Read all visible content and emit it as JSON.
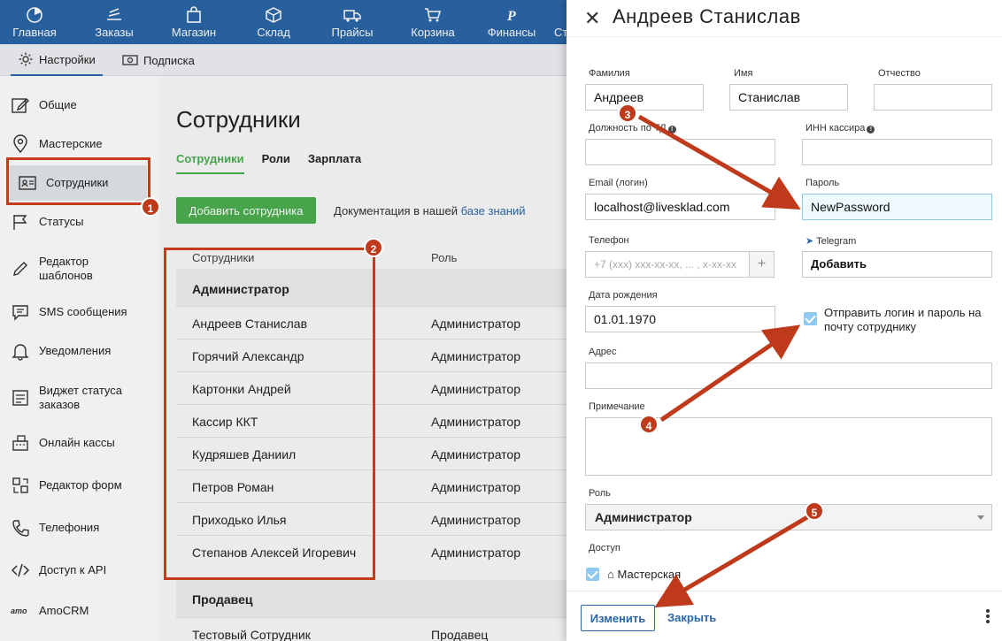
{
  "topnav": {
    "items": [
      {
        "label": "Главная",
        "icon": "dashboard-icon"
      },
      {
        "label": "Заказы",
        "icon": "orders-icon"
      },
      {
        "label": "Магазин",
        "icon": "shop-bag-icon"
      },
      {
        "label": "Склад",
        "icon": "box-icon"
      },
      {
        "label": "Прайсы",
        "icon": "truck-icon"
      },
      {
        "label": "Корзина",
        "icon": "cart-icon"
      },
      {
        "label": "Финансы",
        "icon": "ruble-icon"
      },
      {
        "label": "Ст",
        "icon": ""
      }
    ]
  },
  "subbar": {
    "settings": "Настройки",
    "subscription": "Подписка"
  },
  "sidebar": {
    "items": [
      {
        "label": "Общие"
      },
      {
        "label": "Мастерские"
      },
      {
        "label": "Сотрудники"
      },
      {
        "label": "Статусы"
      },
      {
        "label": "Редактор шаблонов"
      },
      {
        "label": "SMS сообщения"
      },
      {
        "label": "Уведомления"
      },
      {
        "label": "Виджет статуса заказов"
      },
      {
        "label": "Онлайн кассы"
      },
      {
        "label": "Редактор форм"
      },
      {
        "label": "Телефония"
      },
      {
        "label": "Доступ к API"
      },
      {
        "label": "AmoCRM"
      }
    ]
  },
  "main": {
    "title": "Сотрудники",
    "tabs": [
      "Сотрудники",
      "Роли",
      "Зарплата"
    ],
    "add_button": "Добавить сотрудника",
    "doc_prefix": "Документация в нашей",
    "doc_link": "базе знаний",
    "table": {
      "col_name": "Сотрудники",
      "col_role": "Роль",
      "groups": [
        {
          "name": "Администратор",
          "rows": [
            {
              "name": "Андреев Станислав",
              "role": "Администратор"
            },
            {
              "name": "Горячий Александр",
              "role": "Администратор"
            },
            {
              "name": "Картонки Андрей",
              "role": "Администратор"
            },
            {
              "name": "Кассир ККТ",
              "role": "Администратор"
            },
            {
              "name": "Кудряшев Даниил",
              "role": "Администратор"
            },
            {
              "name": "Петров Роман",
              "role": "Администратор"
            },
            {
              "name": "Приходько Илья",
              "role": "Администратор"
            },
            {
              "name": "Степанов Алексей Игоревич",
              "role": "Администратор"
            }
          ]
        },
        {
          "name": "Продавец",
          "rows": [
            {
              "name": "Тестовый Сотрудник",
              "role": "Продавец"
            }
          ]
        }
      ]
    }
  },
  "panel": {
    "title": "Андреев Станислав",
    "labels": {
      "last_name": "Фамилия",
      "first_name": "Имя",
      "middle_name": "Отчество",
      "position": "Должность по ТД",
      "inn": "ИНН кассира",
      "email": "Email (логин)",
      "password": "Пароль",
      "phone": "Телефон",
      "telegram": "Telegram",
      "birth": "Дата рождения",
      "send_credentials": "Отправить логин и пароль на почту сотруднику",
      "address": "Адрес",
      "note": "Примечание",
      "role": "Роль",
      "access": "Доступ",
      "workshop": "Мастерская"
    },
    "values": {
      "last_name": "Андреев",
      "first_name": "Станислав",
      "middle_name": "",
      "position": "",
      "inn": "",
      "email": "localhost@livesklad.com",
      "password": "NewPassword",
      "phone_placeholder": "+7 (xxx) xxx-xx-xx, ... , x-xx-xx",
      "telegram": "Добавить",
      "birth": "01.01.1970",
      "address": "",
      "note": "",
      "role": "Администратор"
    },
    "buttons": {
      "edit": "Изменить",
      "close": "Закрыть"
    }
  },
  "annotations": [
    "1",
    "2",
    "3",
    "4",
    "5"
  ],
  "colors": {
    "nav": "#2b67a8",
    "accent_green": "#4caf50",
    "annotation": "#bf3a1a",
    "link": "#2b67a8"
  }
}
